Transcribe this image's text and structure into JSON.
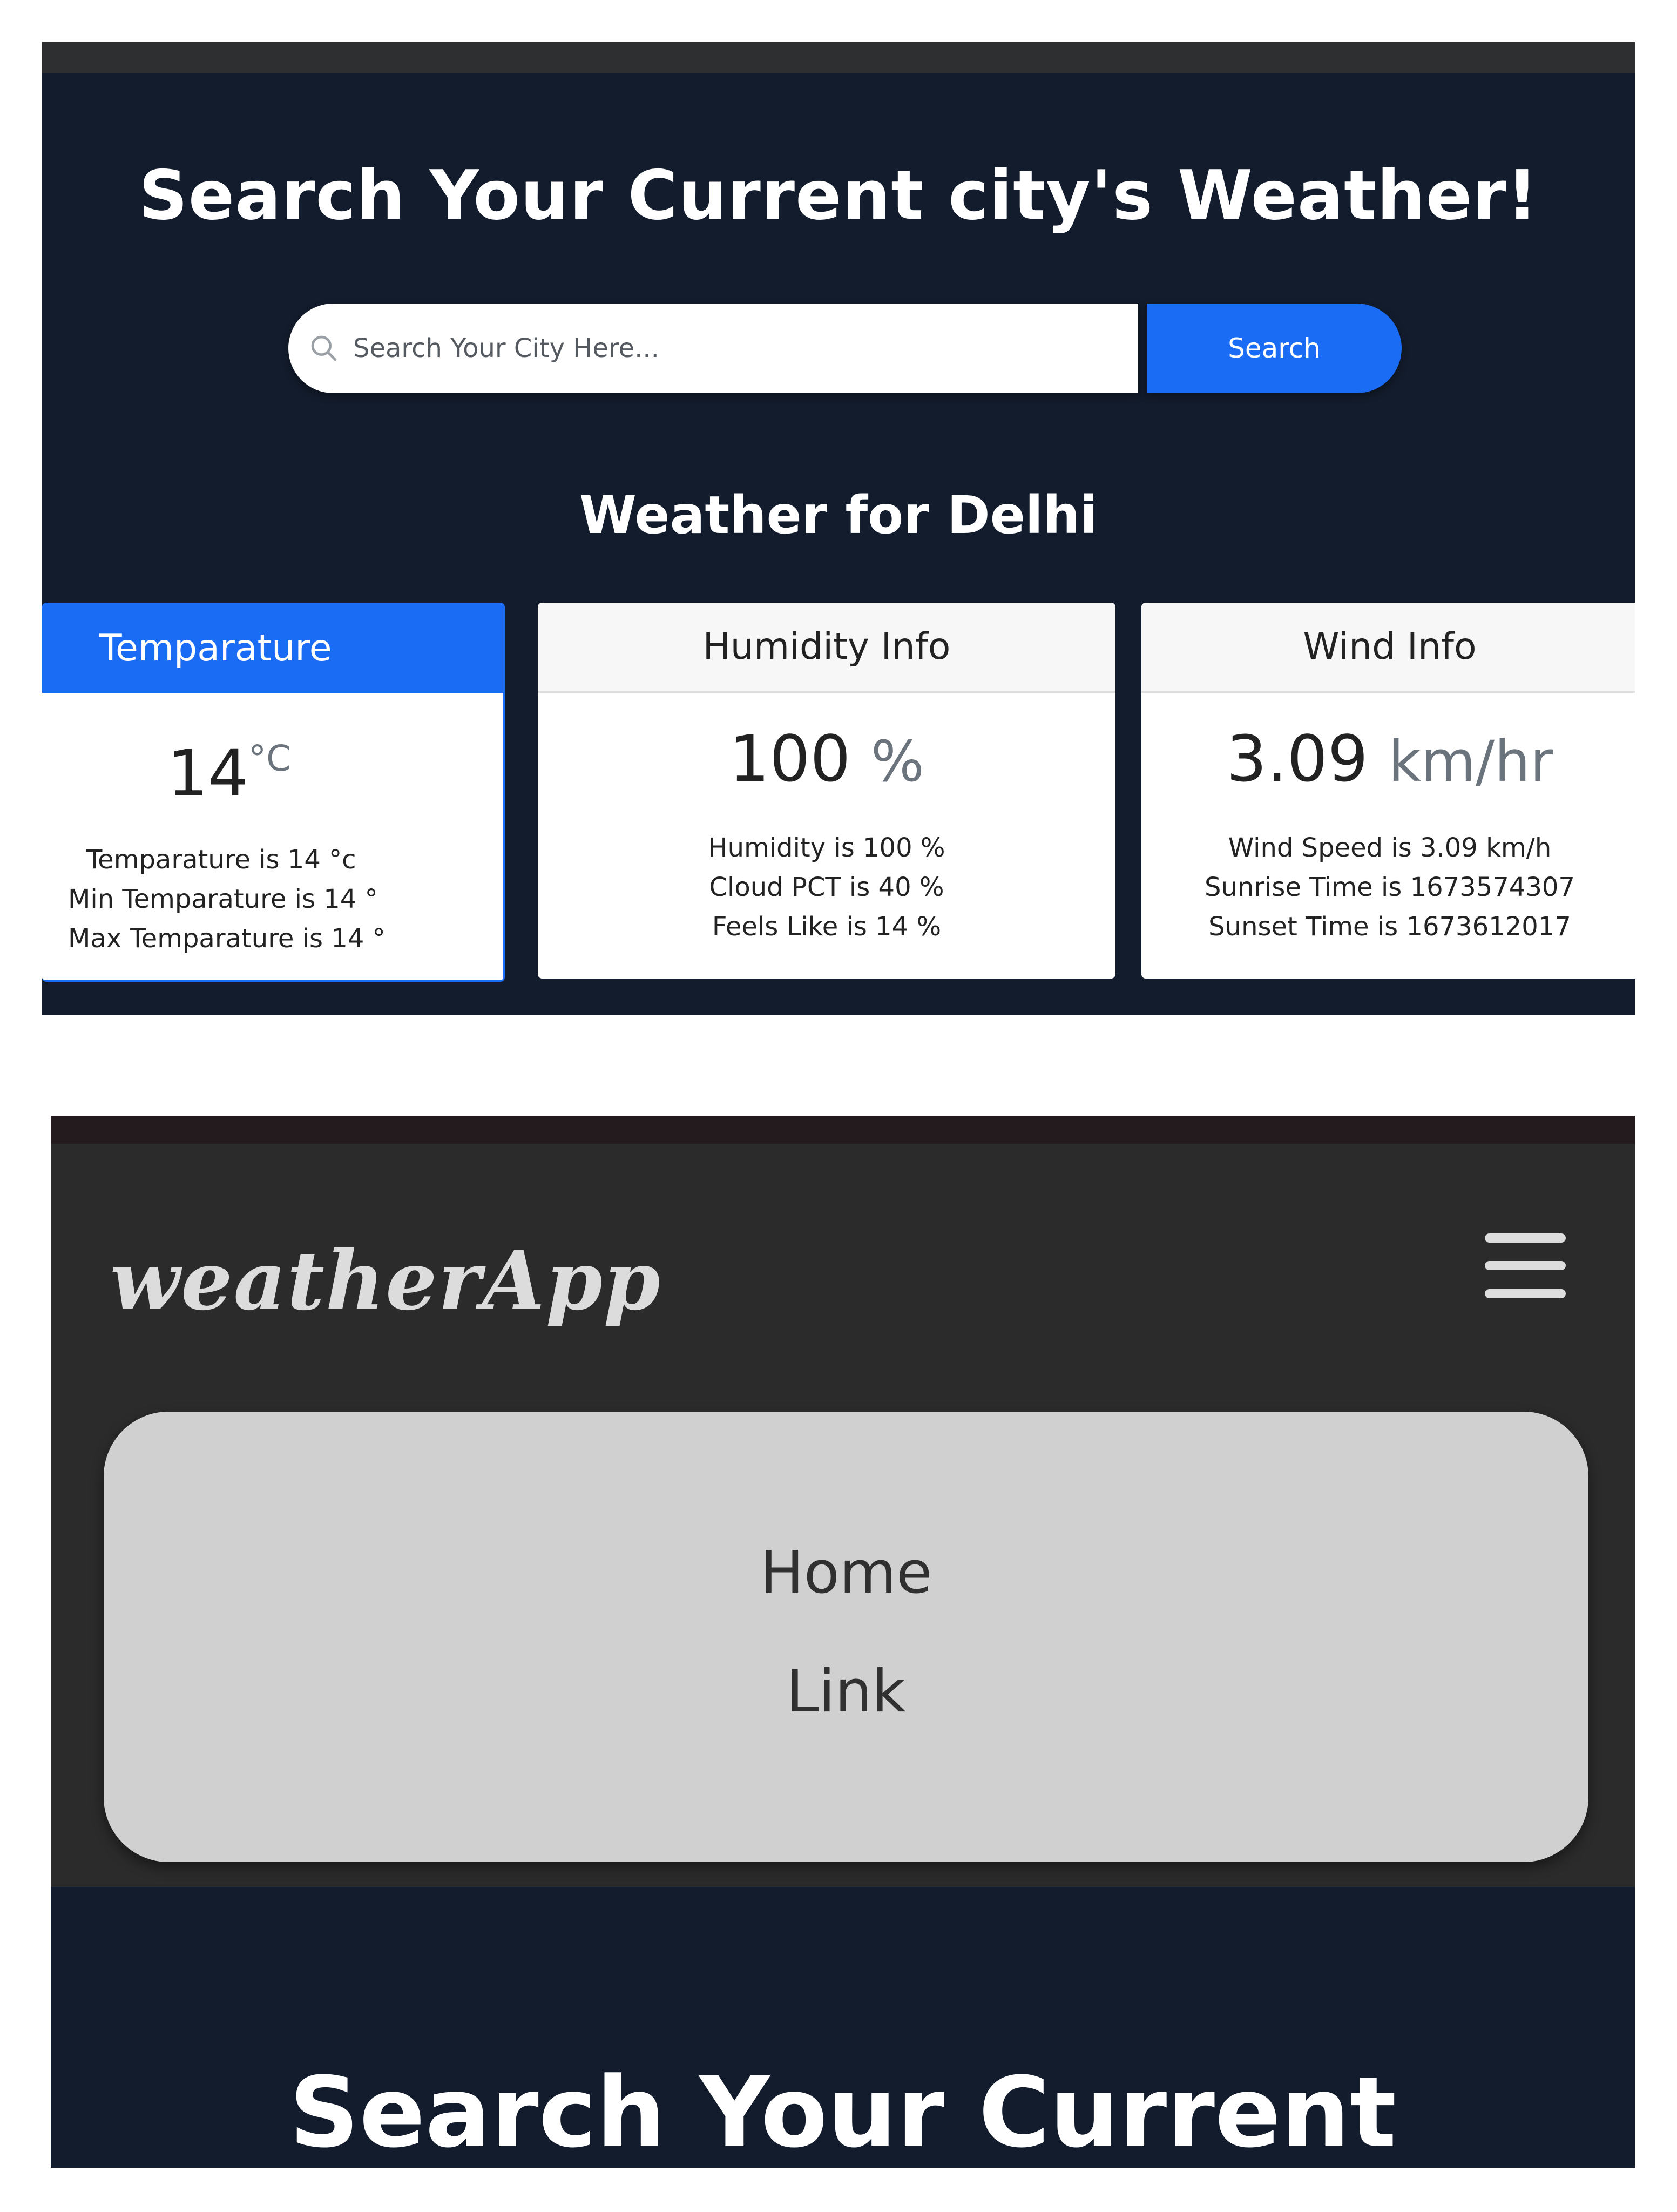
{
  "screen1": {
    "hero_title": "Search Your Current city's Weather!",
    "search": {
      "placeholder": "Search Your City Here...",
      "button_label": "Search"
    },
    "weather_heading": "Weather for Delhi",
    "cards": {
      "temperature": {
        "title": "Temparature",
        "value": "14",
        "unit": "°C",
        "lines": [
          "Temparature is 14 °c",
          "Min Temparature is 14 °",
          "Max Temparature is 14 °"
        ]
      },
      "humidity": {
        "title": "Humidity Info",
        "value": "100",
        "unit": "%",
        "lines": [
          "Humidity is 100 %",
          "Cloud PCT is 40 %",
          "Feels Like is 14 %"
        ]
      },
      "wind": {
        "title": "Wind Info",
        "value": "3.09",
        "unit": "km/hr",
        "lines": [
          "Wind Speed is 3.09 km/h",
          "Sunrise Time is 1673574307",
          "Sunset Time is 1673612017"
        ]
      }
    },
    "colors": {
      "background": "#131c2c",
      "accent": "#1a6cf5"
    }
  },
  "screen2": {
    "brand": "weatherApp",
    "menu_icon": "hamburger-icon",
    "menu_items": [
      "Home",
      "Link"
    ],
    "hero_title_partial": "Search Your Current",
    "colors": {
      "navbar": "#2b2b2b",
      "menu_panel": "#d0d0d0"
    }
  }
}
